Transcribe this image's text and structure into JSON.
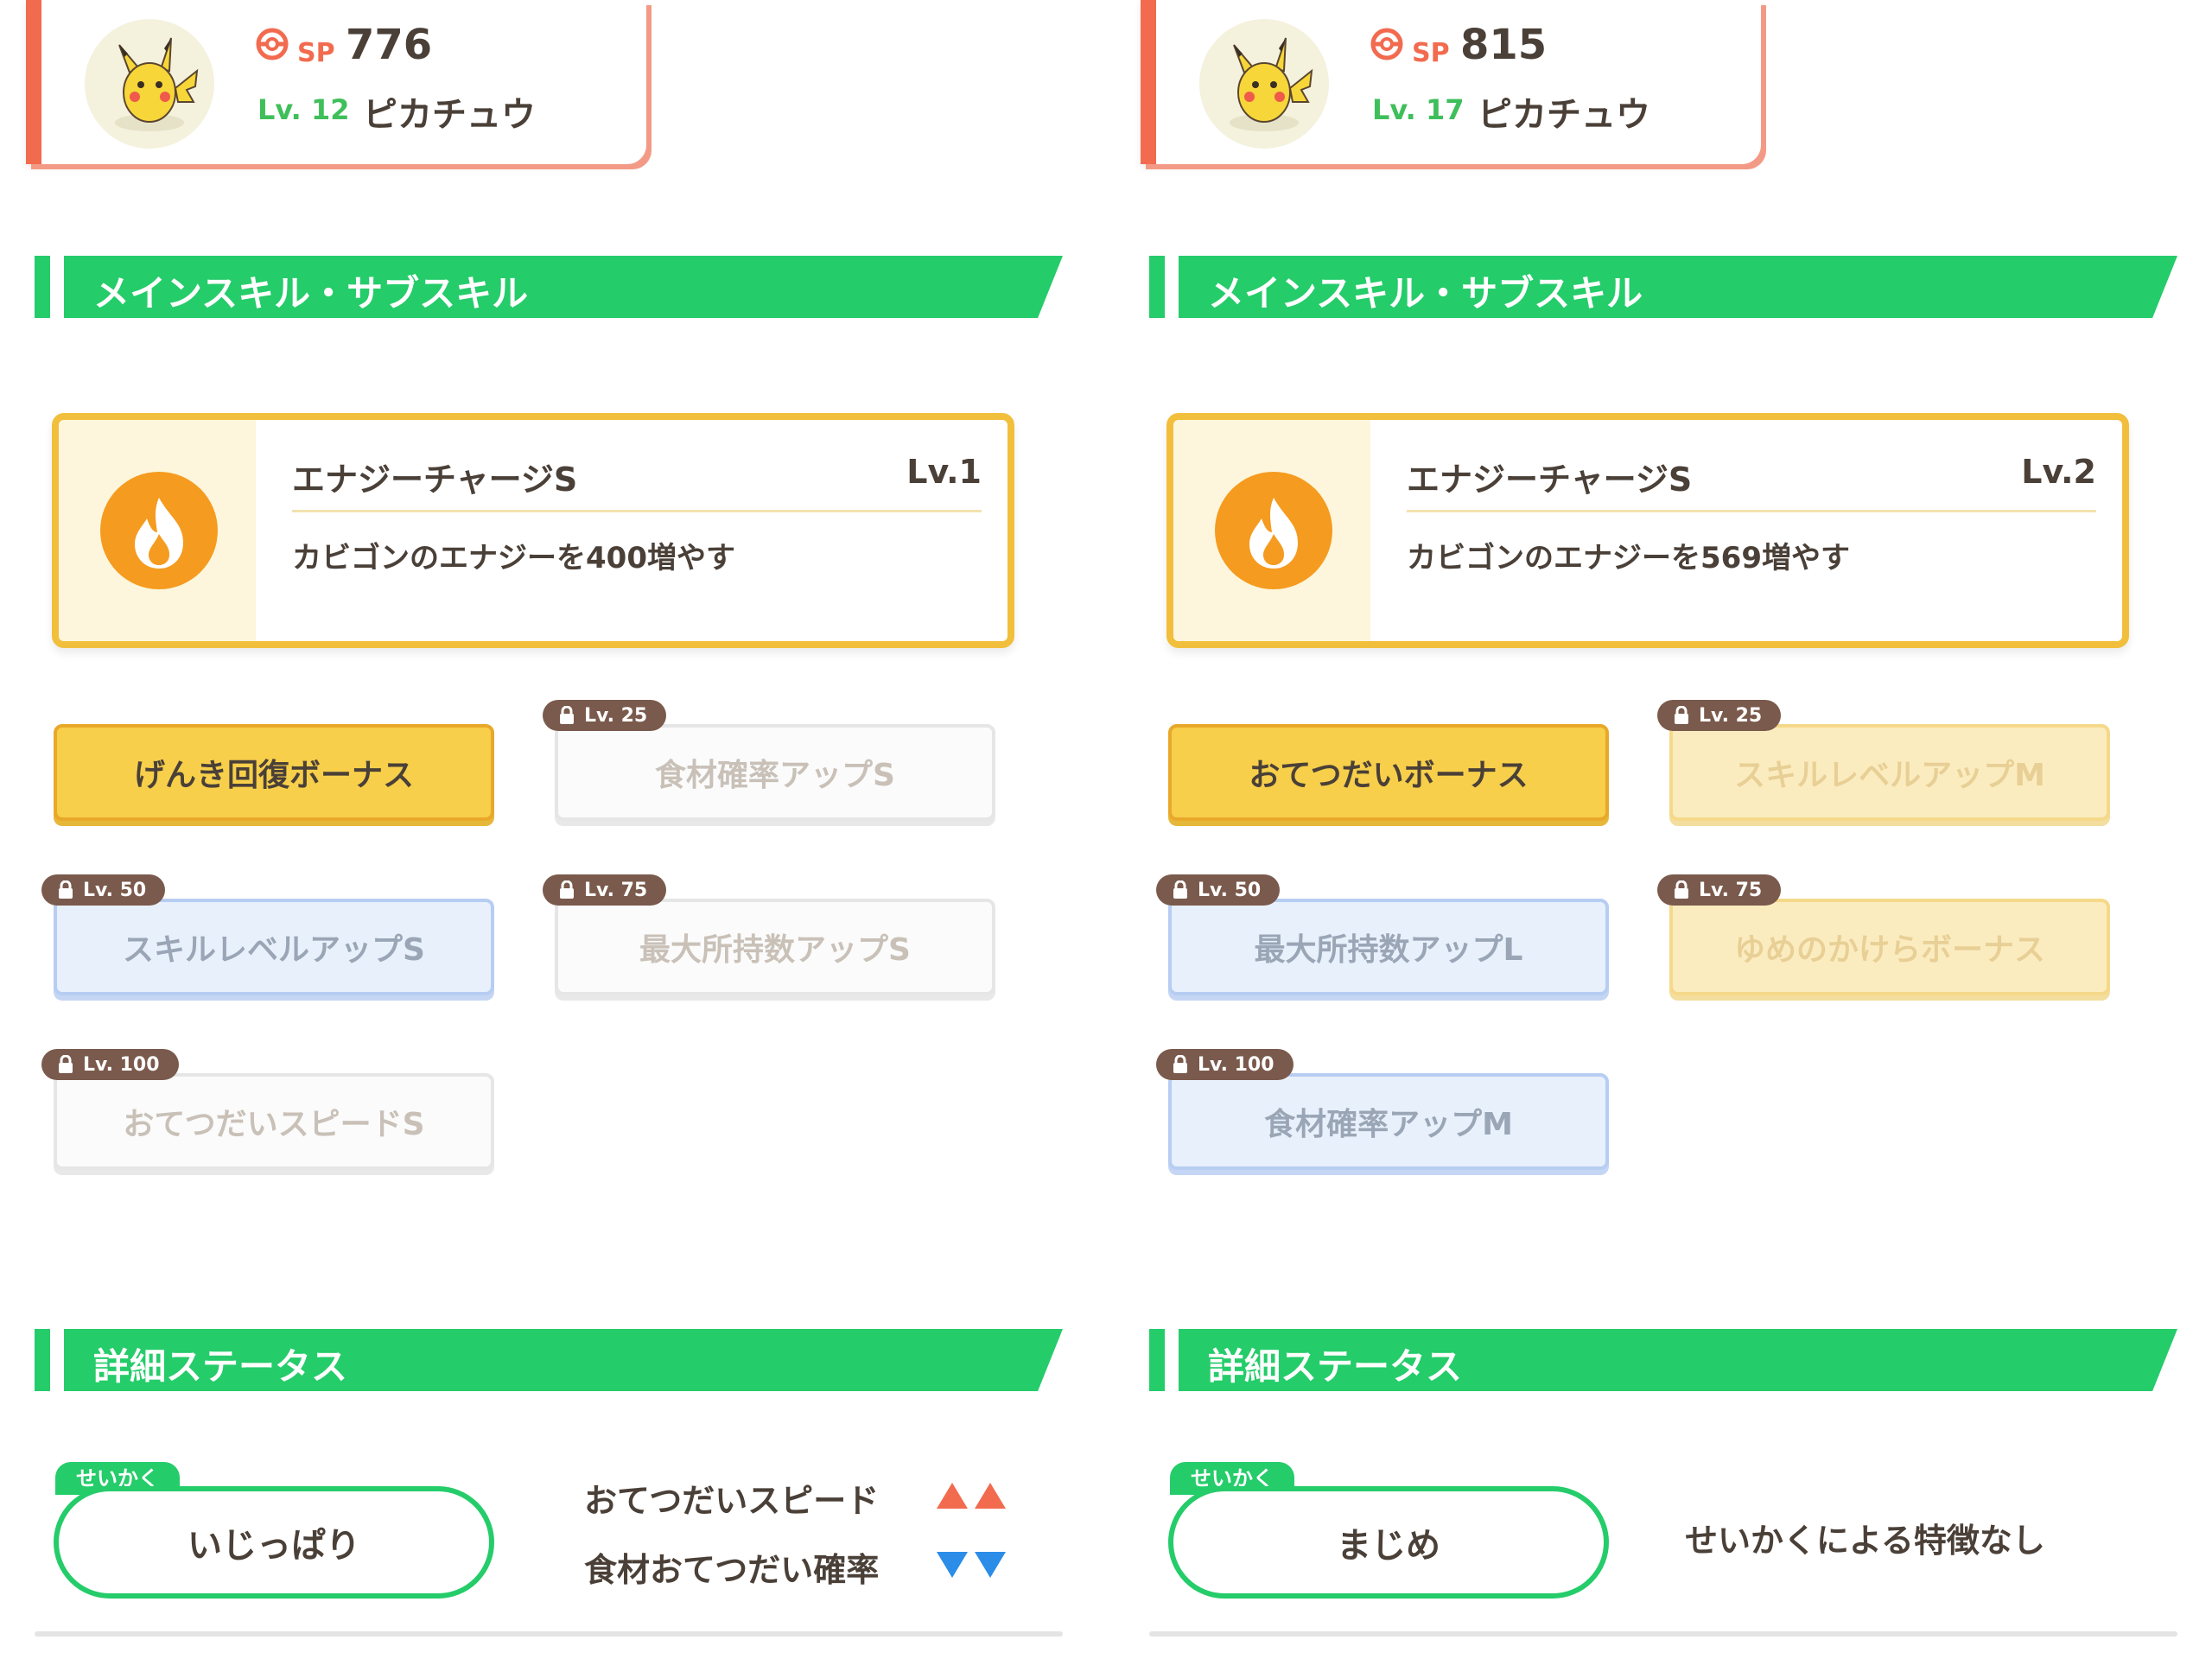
{
  "colors": {
    "accent_green": "#25cc6a",
    "header_orange": "#f26b4f",
    "skill_gold": "#f2bf3c",
    "up_red": "#f26b4f",
    "down_blue": "#2b8de8"
  },
  "panels": [
    {
      "header": {
        "sp_label": "SP",
        "sp_value": "776",
        "level": "Lv. 12",
        "name": "ピカチュウ",
        "avatar_icon": "pikachu-avatar"
      },
      "skills_section_title": "メインスキル・サブスキル",
      "main_skill": {
        "name": "エナジーチャージS",
        "level": "Lv.1",
        "description": "カビゴンのエナジーを400増やす",
        "icon": "flame-icon"
      },
      "sub_skills": [
        {
          "label": "げんき回復ボーナス",
          "style": "gold",
          "lock": ""
        },
        {
          "label": "食材確率アップS",
          "style": "white",
          "lock": "Lv. 25"
        },
        {
          "label": "スキルレベルアップS",
          "style": "blue",
          "lock": "Lv. 50"
        },
        {
          "label": "最大所持数アップS",
          "style": "white",
          "lock": "Lv. 75"
        },
        {
          "label": "おてつだいスピードS",
          "style": "white",
          "lock": "Lv. 100"
        }
      ],
      "status_section_title": "詳細ステータス",
      "nature": {
        "tag": "せいかく",
        "name": "いじっぱり",
        "up_label": "おてつだいスピード",
        "down_label": "食材おてつだい確率",
        "none_label": ""
      }
    },
    {
      "header": {
        "sp_label": "SP",
        "sp_value": "815",
        "level": "Lv. 17",
        "name": "ピカチュウ",
        "avatar_icon": "pikachu-avatar"
      },
      "skills_section_title": "メインスキル・サブスキル",
      "main_skill": {
        "name": "エナジーチャージS",
        "level": "Lv.2",
        "description": "カビゴンのエナジーを569増やす",
        "icon": "flame-icon"
      },
      "sub_skills": [
        {
          "label": "おてつだいボーナス",
          "style": "gold",
          "lock": ""
        },
        {
          "label": "スキルレベルアップM",
          "style": "pale",
          "lock": "Lv. 25"
        },
        {
          "label": "最大所持数アップL",
          "style": "blue",
          "lock": "Lv. 50"
        },
        {
          "label": "ゆめのかけらボーナス",
          "style": "pale",
          "lock": "Lv. 75"
        },
        {
          "label": "食材確率アップM",
          "style": "blue",
          "lock": "Lv. 100"
        }
      ],
      "status_section_title": "詳細ステータス",
      "nature": {
        "tag": "せいかく",
        "name": "まじめ",
        "up_label": "",
        "down_label": "",
        "none_label": "せいかくによる特徴なし"
      }
    }
  ]
}
